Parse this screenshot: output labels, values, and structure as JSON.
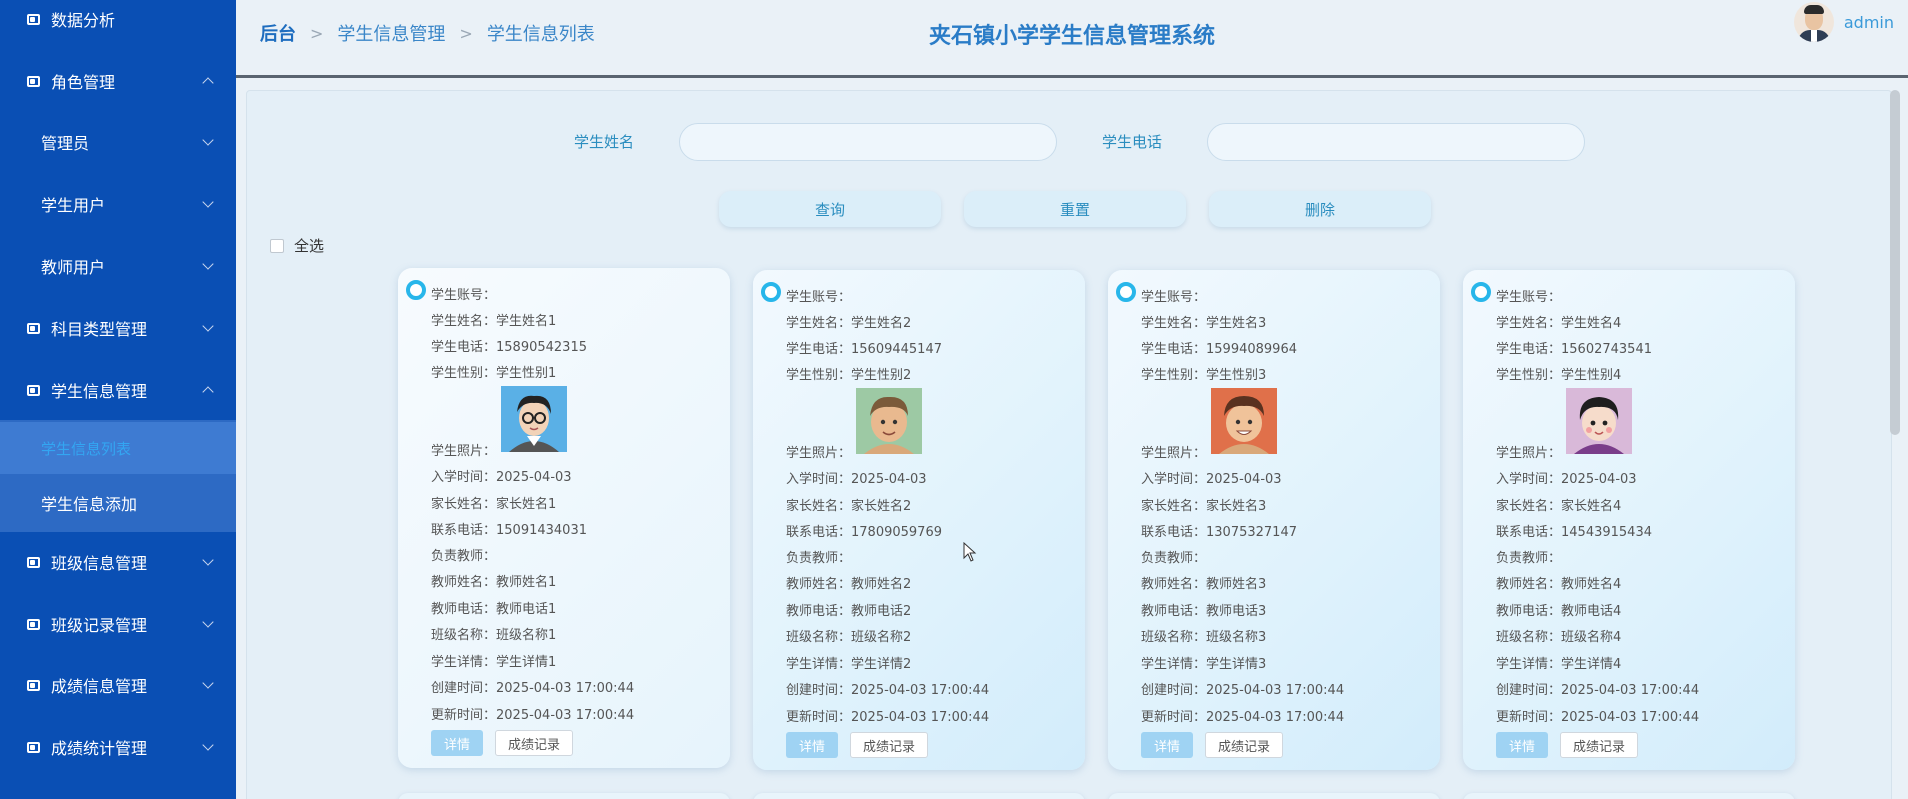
{
  "sidebar": {
    "items": [
      {
        "label": "数据分析"
      },
      {
        "label": "角色管理"
      },
      {
        "label": "管理员"
      },
      {
        "label": "学生用户"
      },
      {
        "label": "教师用户"
      },
      {
        "label": "科目类型管理"
      },
      {
        "label": "学生信息管理"
      },
      {
        "label": "学生信息列表"
      },
      {
        "label": "学生信息添加"
      },
      {
        "label": "班级信息管理"
      },
      {
        "label": "班级记录管理"
      },
      {
        "label": "成绩信息管理"
      },
      {
        "label": "成绩统计管理"
      }
    ],
    "active_color": "#33a6f2"
  },
  "header": {
    "breadcrumb": [
      "后台",
      "学生信息管理",
      "学生信息列表"
    ],
    "title": "夹石镇小学学生信息管理系统",
    "user": "admin"
  },
  "search": {
    "name_label": "学生姓名",
    "phone_label": "学生电话",
    "name_value": "",
    "phone_value": ""
  },
  "actions": {
    "query": "查询",
    "reset": "重置",
    "delete": "删除",
    "select_all": "全选"
  },
  "labels": {
    "account": "学生账号：",
    "name": "学生姓名：",
    "phone": "学生电话：",
    "gender": "学生性别：",
    "photo": "学生照片：",
    "enroll": "入学时间：",
    "parent": "家长姓名：",
    "contact": "联系电话：",
    "teacher": "负责教师：",
    "teacher_name": "教师姓名：",
    "teacher_phone": "教师电话：",
    "class": "班级名称：",
    "detail": "学生详情：",
    "created": "创建时间：",
    "updated": "更新时间：",
    "btn_detail": "详情",
    "btn_record": "成绩记录"
  },
  "students": [
    {
      "account": "",
      "name": "学生姓名1",
      "phone": "15890542315",
      "gender": "学生性别1",
      "enroll": "2025-04-03",
      "parent": "家长姓名1",
      "contact": "15091434031",
      "teacher": "",
      "teacher_name": "教师姓名1",
      "teacher_phone": "教师电话1",
      "class": "班级名称1",
      "detail": "学生详情1",
      "created": "2025-04-03 17:00:44",
      "updated": "2025-04-03 17:00:44",
      "photo_icon": "boy-glasses-avatar"
    },
    {
      "account": "",
      "name": "学生姓名2",
      "phone": "15609445147",
      "gender": "学生性别2",
      "enroll": "2025-04-03",
      "parent": "家长姓名2",
      "contact": "17809059769",
      "teacher": "",
      "teacher_name": "教师姓名2",
      "teacher_phone": "教师电话2",
      "class": "班级名称2",
      "detail": "学生详情2",
      "created": "2025-04-03 17:00:44",
      "updated": "2025-04-03 17:00:44",
      "photo_icon": "boy-avatar-green"
    },
    {
      "account": "",
      "name": "学生姓名3",
      "phone": "15994089964",
      "gender": "学生性别3",
      "enroll": "2025-04-03",
      "parent": "家长姓名3",
      "contact": "13075327147",
      "teacher": "",
      "teacher_name": "教师姓名3",
      "teacher_phone": "教师电话3",
      "class": "班级名称3",
      "detail": "学生详情3",
      "created": "2025-04-03 17:00:44",
      "updated": "2025-04-03 17:00:44",
      "photo_icon": "boy-avatar-orange"
    },
    {
      "account": "",
      "name": "学生姓名4",
      "phone": "15602743541",
      "gender": "学生性别4",
      "enroll": "2025-04-03",
      "parent": "家长姓名4",
      "contact": "14543915434",
      "teacher": "",
      "teacher_name": "教师姓名4",
      "teacher_phone": "教师电话4",
      "class": "班级名称4",
      "detail": "学生详情4",
      "created": "2025-04-03 17:00:44",
      "updated": "2025-04-03 17:00:44",
      "photo_icon": "girl-avatar-purple"
    }
  ]
}
